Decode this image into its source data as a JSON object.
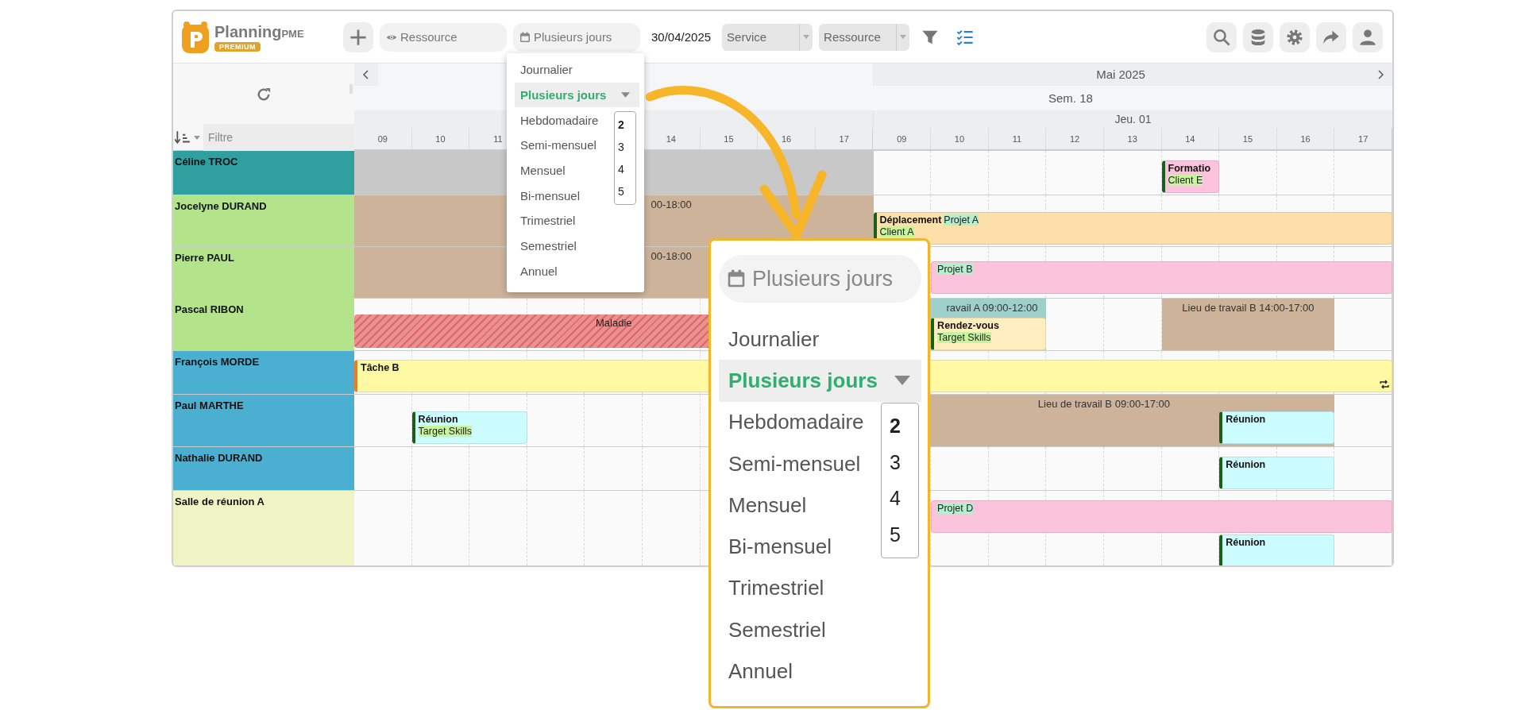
{
  "toolbar": {
    "logo": {
      "name": "Planning",
      "suffix": "PME",
      "badge": "PREMIUM"
    },
    "resource_search": {
      "placeholder": "Ressource"
    },
    "view_button": {
      "label": "Plusieurs jours"
    },
    "date": "30/04/2025",
    "selects": [
      {
        "value": "Service"
      },
      {
        "value": "Ressource"
      }
    ]
  },
  "view_menu": {
    "items": [
      {
        "label": "Journalier",
        "selected": false
      },
      {
        "label": "Plusieurs jours",
        "selected": true,
        "has_submenu": true
      },
      {
        "label": "Hebdomadaire",
        "selected": false
      },
      {
        "label": "Semi-mensuel",
        "selected": false
      },
      {
        "label": "Mensuel",
        "selected": false
      },
      {
        "label": "Bi-mensuel",
        "selected": false
      },
      {
        "label": "Trimestriel",
        "selected": false
      },
      {
        "label": "Semestriel",
        "selected": false
      },
      {
        "label": "Annuel",
        "selected": false
      }
    ],
    "day_counts": [
      {
        "label": "2",
        "selected": true
      },
      {
        "label": "3",
        "selected": false
      },
      {
        "label": "4",
        "selected": false
      },
      {
        "label": "5",
        "selected": false
      }
    ]
  },
  "zoom_callout": {
    "view_button": {
      "label": "Plusieurs jours"
    },
    "items": [
      {
        "label": "Journalier",
        "selected": false
      },
      {
        "label": "Plusieurs jours",
        "selected": true,
        "has_submenu": true
      },
      {
        "label": "Hebdomadaire",
        "selected": false
      },
      {
        "label": "Semi-mensuel",
        "selected": false
      },
      {
        "label": "Mensuel",
        "selected": false
      },
      {
        "label": "Bi-mensuel",
        "selected": false
      },
      {
        "label": "Trimestriel",
        "selected": false
      },
      {
        "label": "Semestriel",
        "selected": false
      },
      {
        "label": "Annuel",
        "selected": false
      }
    ],
    "day_counts": [
      {
        "label": "2",
        "selected": true
      },
      {
        "label": "3",
        "selected": false
      },
      {
        "label": "4",
        "selected": false
      },
      {
        "label": "5",
        "selected": false
      }
    ]
  },
  "sidebar": {
    "filter_placeholder": "Filtre"
  },
  "timeline": {
    "month": "Mai 2025",
    "week": "Sem. 18",
    "days": [
      {
        "hours": [
          "09",
          "10",
          "11",
          "14",
          "15",
          "16",
          "17"
        ]
      },
      {
        "label": "Jeu. 01",
        "hours": [
          "09",
          "10",
          "11",
          "12",
          "13",
          "14",
          "15",
          "16",
          "17"
        ]
      }
    ]
  },
  "resources": [
    {
      "name": "Céline TROC",
      "color": "#2f9fa0",
      "events": [
        {
          "kind": "background",
          "color": "#c8c8c8"
        },
        {
          "kind": "appointment",
          "color": "#fcc4dc",
          "title": "Formatio",
          "tags": [
            {
              "kind": "client",
              "text": "Client E"
            }
          ]
        }
      ]
    },
    {
      "name": "Jocelyne DURAND",
      "color": "#b3e38a",
      "events": [
        {
          "kind": "background",
          "color": "#cdb39a",
          "label": "00-18:00"
        },
        {
          "kind": "appointment",
          "color": "#fde0a9",
          "title": "Déplacement",
          "tags": [
            {
              "kind": "project",
              "text": "Projet A"
            },
            {
              "kind": "client",
              "text": "Client A"
            }
          ]
        }
      ]
    },
    {
      "name": "Pierre PAUL",
      "color": "#b3e38a",
      "events": [
        {
          "kind": "background",
          "color": "#cdb39a",
          "label": "00-18:00"
        },
        {
          "kind": "project",
          "color": "#fcc4dc",
          "tags": [
            {
              "kind": "project",
              "text": "Projet B"
            }
          ]
        }
      ]
    },
    {
      "name": "Pascal RIBON",
      "color": "#b3e38a",
      "events": [
        {
          "kind": "background",
          "color": "#9fcfcb",
          "label": "ravail A 09:00-12:00"
        },
        {
          "kind": "background",
          "color": "#cdb39a",
          "label": "Lieu de travail B 14:00-17:00"
        },
        {
          "kind": "absence",
          "color": "#ec8f8f",
          "title": "Maladie"
        },
        {
          "kind": "appointment",
          "color": "#feeebf",
          "title": "Rendez-vous",
          "tags": [
            {
              "kind": "client",
              "text": "Target Skills"
            }
          ]
        }
      ]
    },
    {
      "name": "François MORDE",
      "color": "#4aafd0",
      "events": [
        {
          "kind": "task",
          "color": "#fff9a3",
          "title": "Tâche B",
          "repeat": true
        }
      ]
    },
    {
      "name": "Paul MARTHE",
      "color": "#4aafd0",
      "events": [
        {
          "kind": "background",
          "color": "#cdb39a",
          "label": "Lieu de travail B 09:00-17:00"
        },
        {
          "kind": "appointment",
          "color": "#ccfcff",
          "title": "Réunion",
          "tags": [
            {
              "kind": "client",
              "text": "Target Skills"
            }
          ]
        },
        {
          "kind": "appointment",
          "color": "#ccfcff",
          "title": "Réunion"
        }
      ]
    },
    {
      "name": "Nathalie DURAND",
      "color": "#4aafd0",
      "events": [
        {
          "kind": "appointment",
          "color": "#ccfcff",
          "title": "Réunion"
        }
      ]
    },
    {
      "name": "Salle de réunion A",
      "color": "#f0f4c5",
      "events": [
        {
          "kind": "project",
          "color": "#fcc4dc",
          "tags": [
            {
              "kind": "project",
              "text": "Projet D"
            }
          ]
        },
        {
          "kind": "appointment",
          "color": "#ccfcff",
          "title": "Réunion"
        }
      ]
    }
  ]
}
